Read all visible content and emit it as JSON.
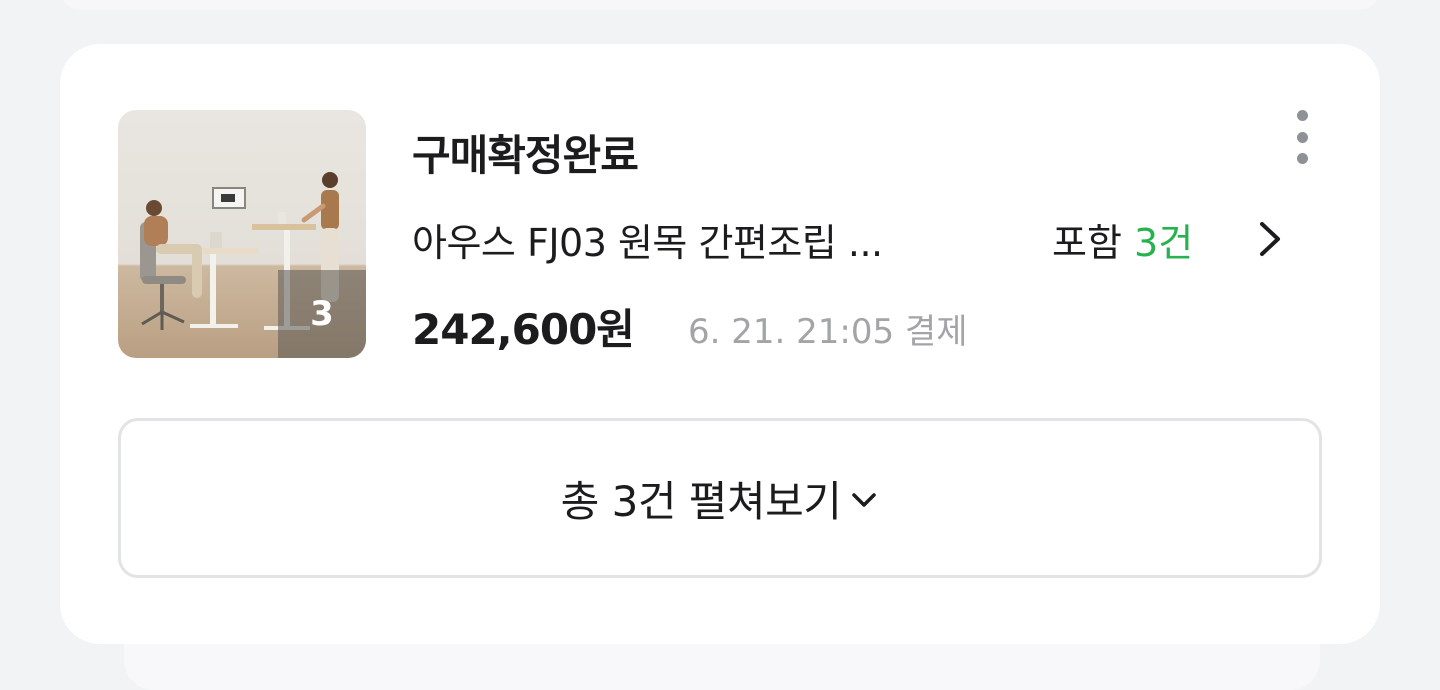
{
  "order": {
    "status": "구매확정완료",
    "product_name": "아우스 FJ03 원목 간편조립 ...",
    "include_prefix": "포함",
    "include_count": "3건",
    "price": "242,600원",
    "payment_info": "6. 21. 21:05 결제",
    "thumbnail_count": "3",
    "menu_icon": "more-vertical-icon",
    "detail_icon": "chevron-right-icon"
  },
  "expand_button": {
    "label": "총 3건 펼쳐보기",
    "icon": "chevron-down-icon"
  },
  "colors": {
    "accent_green": "#27b24f",
    "muted_text": "#a2a4a8",
    "card_bg": "#ffffff",
    "page_bg": "#f2f3f5"
  }
}
